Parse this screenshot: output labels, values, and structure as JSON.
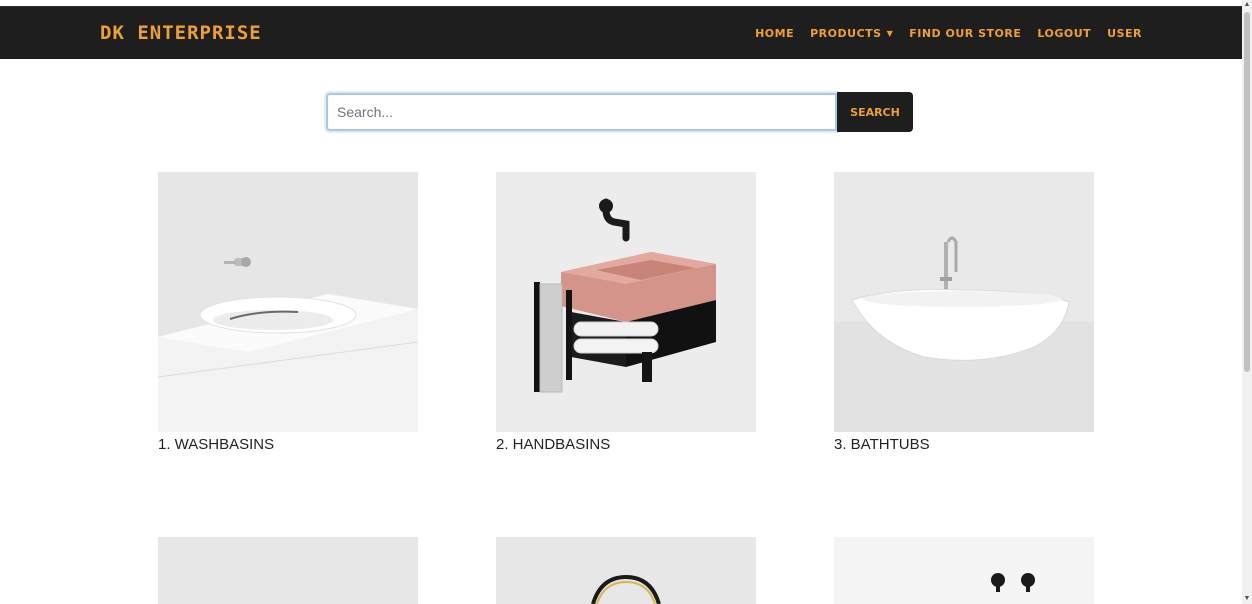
{
  "brand": "DK ENTERPRISE",
  "nav": {
    "home": "HOME",
    "products": "PRODUCTS",
    "find_store": "FIND OUR STORE",
    "logout": "LOGOUT",
    "user": "USER"
  },
  "search": {
    "placeholder": "Search...",
    "button_label": "SEARCH"
  },
  "products": [
    {
      "label": "1. WASHBASINS",
      "image": "washbasin-photo"
    },
    {
      "label": "2. HANDBASINS",
      "image": "handbasin-photo"
    },
    {
      "label": "3. BATHTUBS",
      "image": "bathtub-photo"
    },
    {
      "label": "",
      "image": "product-photo"
    },
    {
      "label": "",
      "image": "mirror-photo"
    },
    {
      "label": "",
      "image": "tap-photo"
    }
  ],
  "colors": {
    "navbar_bg": "#1e1e1e",
    "accent": "#f0a030",
    "search_focus": "#a6c8ef"
  }
}
